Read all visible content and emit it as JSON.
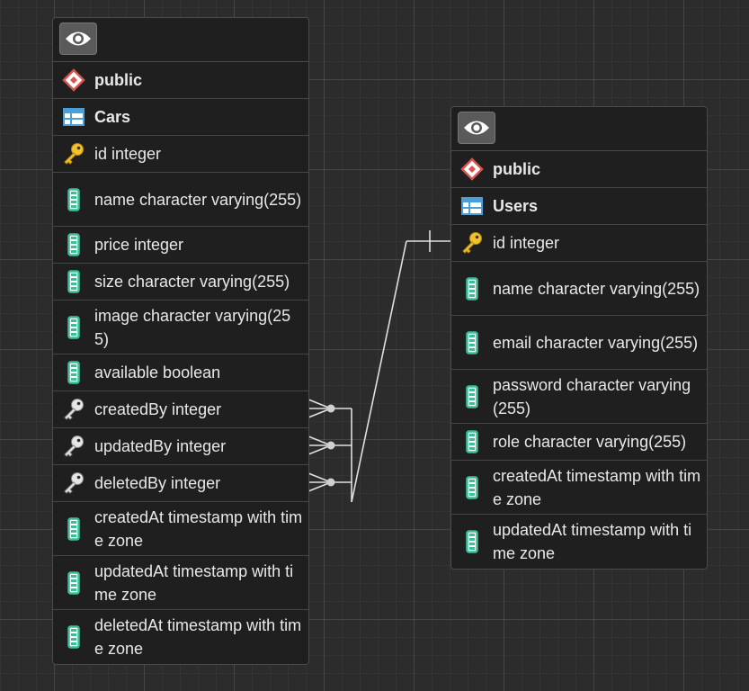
{
  "tables": [
    {
      "schema": "public",
      "name": "Cars",
      "columns": [
        {
          "label": "id integer",
          "kind": "pk"
        },
        {
          "label": "name character varying(255)",
          "kind": "col"
        },
        {
          "label": "price integer",
          "kind": "col"
        },
        {
          "label": "size character varying(255)",
          "kind": "col"
        },
        {
          "label": "image character varying(255)",
          "kind": "col"
        },
        {
          "label": "available boolean",
          "kind": "col"
        },
        {
          "label": "createdBy integer",
          "kind": "fk"
        },
        {
          "label": "updatedBy integer",
          "kind": "fk"
        },
        {
          "label": "deletedBy integer",
          "kind": "fk"
        },
        {
          "label": "createdAt timestamp with time zone",
          "kind": "col"
        },
        {
          "label": "updatedAt timestamp with time zone",
          "kind": "col"
        },
        {
          "label": "deletedAt timestamp with time zone",
          "kind": "col"
        }
      ]
    },
    {
      "schema": "public",
      "name": "Users",
      "columns": [
        {
          "label": "id integer",
          "kind": "pk"
        },
        {
          "label": "name character varying(255)",
          "kind": "col"
        },
        {
          "label": "email character varying(255)",
          "kind": "col"
        },
        {
          "label": "password character varying (255)",
          "kind": "col"
        },
        {
          "label": "role character varying(255)",
          "kind": "col"
        },
        {
          "label": "createdAt timestamp with time zone",
          "kind": "col"
        },
        {
          "label": "updatedAt timestamp with time zone",
          "kind": "col"
        }
      ]
    }
  ],
  "relationships": [
    {
      "from": "Cars.createdBy",
      "to": "Users.id",
      "from_cardinality": "many",
      "to_cardinality": "one"
    },
    {
      "from": "Cars.updatedBy",
      "to": "Users.id",
      "from_cardinality": "many",
      "to_cardinality": "one"
    },
    {
      "from": "Cars.deletedBy",
      "to": "Users.id",
      "from_cardinality": "many",
      "to_cardinality": "one"
    }
  ],
  "icons": {
    "visibility": "eye-icon",
    "schema": "schema-diamond-icon",
    "table": "table-grid-icon",
    "primary_key": "primary-key-icon",
    "foreign_key": "foreign-key-icon",
    "column": "column-icon"
  },
  "colors": {
    "background": "#2c2c2c",
    "table_bg": "#1f1f1f",
    "text": "#e8e8e8",
    "schema_icon": "#d9534f",
    "table_icon": "#4a9fd8",
    "primary_key": "#f2c12e",
    "column_icon": "#3bbf99",
    "foreign_key": "#bcbcbc",
    "connector": "#e0e0e0"
  }
}
